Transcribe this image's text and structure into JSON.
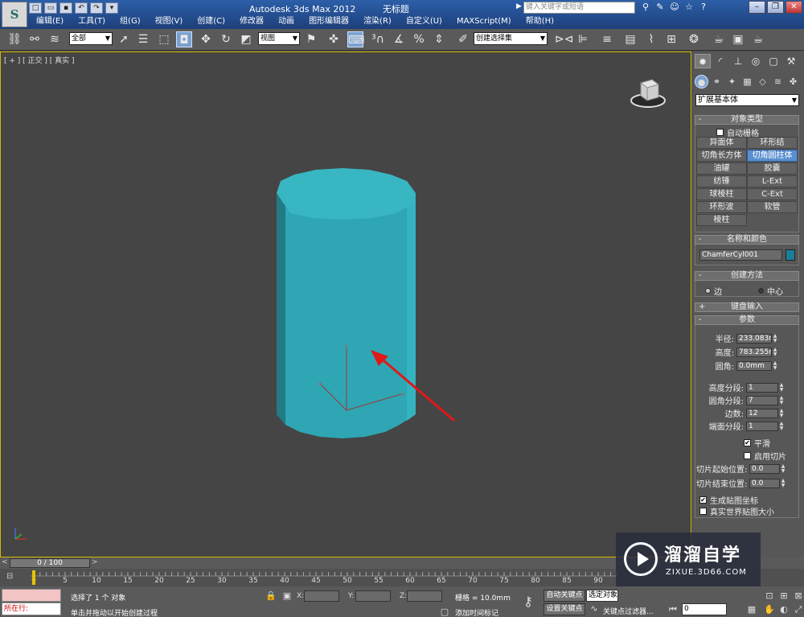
{
  "window": {
    "title": "Autodesk 3ds Max  2012",
    "file_title": "无标题",
    "search_placeholder": "键入关键字或短语",
    "menu": [
      "编辑(E)",
      "工具(T)",
      "组(G)",
      "视图(V)",
      "创建(C)",
      "修改器",
      "动画",
      "图形编辑器",
      "渲染(R)",
      "自定义(U)",
      "MAXScript(M)",
      "帮助(H)"
    ]
  },
  "toolbar": {
    "selection_filter": "全部",
    "ref_coord": "视图",
    "named_selection": "创建选择集"
  },
  "viewport": {
    "label": "[ + ] [ 正交 ] [ 真实 ]",
    "object_color": "#2ea6b3"
  },
  "command_panel": {
    "subcategory": "扩展基本体",
    "object_type": {
      "title": "对象类型",
      "autogrid": "自动栅格",
      "buttons": [
        "异面体",
        "环形结",
        "切角长方体",
        "切角圆柱体",
        "油罐",
        "胶囊",
        "纺锤",
        "L-Ext",
        "球棱柱",
        "C-Ext",
        "环形波",
        "软管",
        "棱柱"
      ],
      "active": "切角圆柱体"
    },
    "name_color": {
      "title": "名称和颜色",
      "name": "ChamferCyl001",
      "color": "#1a7f99"
    },
    "creation_method": {
      "title": "创建方法",
      "options": [
        "边",
        "中心"
      ],
      "selected": "中心"
    },
    "keyboard_entry": {
      "title": "键盘输入"
    },
    "parameters": {
      "title": "参数",
      "radius_label": "半径:",
      "radius": "233.083m",
      "height_label": "高度:",
      "height": "783.255m",
      "fillet_label": "圆角:",
      "fillet": "0.0mm",
      "height_segs_label": "高度分段:",
      "height_segs": "1",
      "fillet_segs_label": "圆角分段:",
      "fillet_segs": "7",
      "sides_label": "边数:",
      "sides": "12",
      "cap_segs_label": "端面分段:",
      "cap_segs": "1",
      "smooth_label": "平滑",
      "slice_on_label": "启用切片",
      "slice_from_label": "切片起始位置:",
      "slice_from": "0.0",
      "slice_to_label": "切片结束位置:",
      "slice_to": "0.0",
      "gen_map_label": "生成贴图坐标",
      "real_world_label": "真实世界贴图大小"
    }
  },
  "timeline": {
    "slider": "0 / 100",
    "ticks": [
      "0",
      "5",
      "10",
      "15",
      "20",
      "25",
      "30",
      "35",
      "40",
      "45",
      "50",
      "55",
      "60",
      "65",
      "70",
      "75",
      "80",
      "85",
      "90"
    ]
  },
  "status": {
    "listener_text": "所在行:",
    "selection_info": "选择了 1 个 对象",
    "prompt": "单击并拖动以开始创建过程",
    "x_label": "X:",
    "y_label": "Y:",
    "z_label": "Z:",
    "grid": "栅格 = 10.0mm",
    "auto_key": "自动关键点",
    "set_key": "设置关键点",
    "selected_field": "选定对象",
    "add_time_tag": "添加时间标记",
    "key_filters": "关键点过滤器...",
    "frame": "0"
  },
  "watermark": {
    "brand": "溜溜自学",
    "url": "ZIXUE.3D66.COM"
  }
}
